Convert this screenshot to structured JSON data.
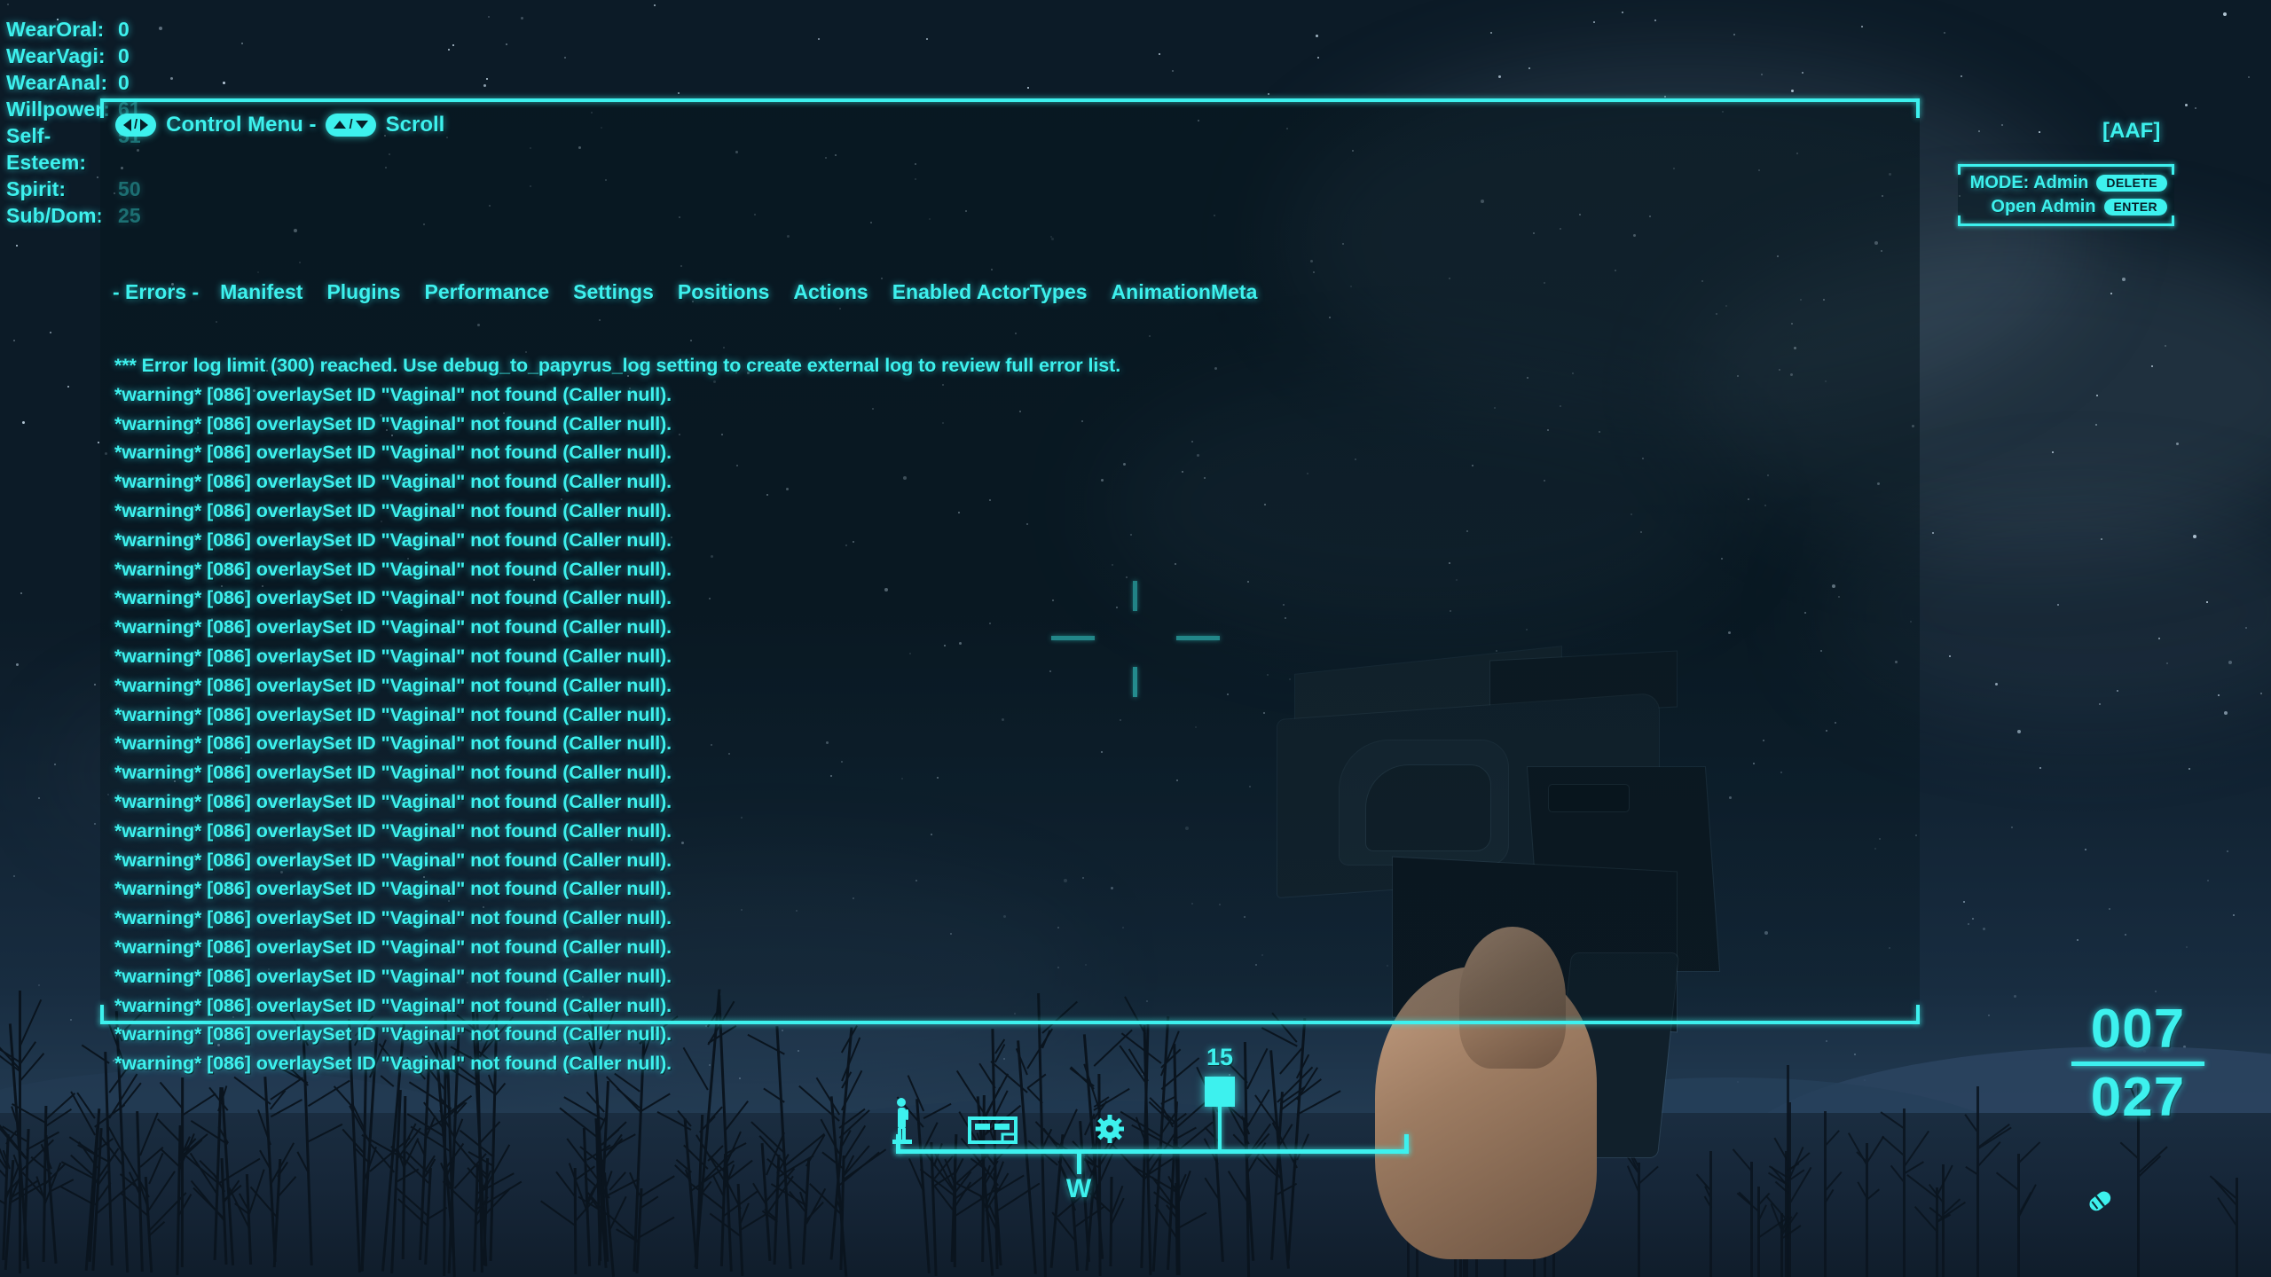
{
  "accent_color": "#3df1ee",
  "stats": {
    "rows": [
      {
        "label": "WearOral:",
        "value": "0"
      },
      {
        "label": "WearVagi:",
        "value": "0"
      },
      {
        "label": "WearAnal:",
        "value": "0"
      },
      {
        "label": "Willpower:",
        "value": "61"
      },
      {
        "label": "Self-Esteem:",
        "value": "51"
      },
      {
        "label": "Spirit:",
        "value": "50"
      },
      {
        "label": "Sub/Dom:",
        "value": "25"
      }
    ]
  },
  "panel": {
    "control_hint": {
      "left_right_keys": "left-right-arrow-keys",
      "label_menu": "Control Menu  -",
      "up_down_keys": "up-down-arrow-keys",
      "label_scroll": "Scroll"
    },
    "tabs": [
      {
        "label": "- Errors -",
        "selected": true
      },
      {
        "label": "Manifest",
        "selected": false
      },
      {
        "label": "Plugins",
        "selected": false
      },
      {
        "label": "Performance",
        "selected": false
      },
      {
        "label": "Settings",
        "selected": false
      },
      {
        "label": "Positions",
        "selected": false
      },
      {
        "label": "Actions",
        "selected": false
      },
      {
        "label": "Enabled ActorTypes",
        "selected": false
      },
      {
        "label": "AnimationMeta",
        "selected": false
      }
    ],
    "log": {
      "header": "*** Error log limit (300) reached. Use debug_to_papyrus_log setting to create external log to review full error list.",
      "warning_line": "*warning* [086] overlaySet ID \"Vaginal\" not found (Caller null).",
      "warning_count": 24
    }
  },
  "aaf_tag": "[AAF]",
  "admin_box": {
    "mode_label": "MODE: Admin",
    "mode_key": "DELETE",
    "open_label": "Open Admin",
    "open_key": "ENTER"
  },
  "compass": {
    "direction_label": "W",
    "marker_number": "15",
    "icons": [
      "person-icon",
      "workbench-icon",
      "gear-icon",
      "quest-marker-icon"
    ]
  },
  "ammo": {
    "current": "007",
    "reserve": "027",
    "item_icon": "stimpak-icon"
  }
}
